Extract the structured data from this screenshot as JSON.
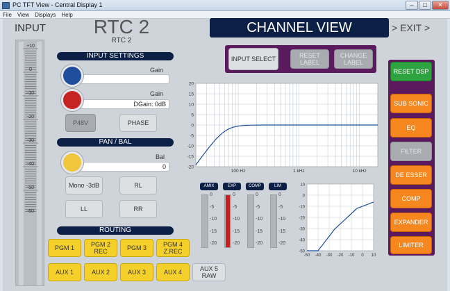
{
  "window": {
    "title": "PC TFT View - Central Display 1",
    "controls": [
      "–",
      "□",
      "✕"
    ]
  },
  "menu": [
    "File",
    "View",
    "Displays",
    "Help"
  ],
  "input_meter": {
    "title": "INPUT",
    "ticks": [
      "+10",
      "0",
      "-10",
      "-20",
      "-30",
      "-40",
      "-50",
      "-60"
    ]
  },
  "channel": {
    "name": "RTC 2",
    "subname": "RTC 2"
  },
  "view_title": "CHANNEL VIEW",
  "exit_label": "> EXIT >",
  "input_settings": {
    "header": "INPUT SETTINGS",
    "gain1_label": "Gain",
    "gain1_value": "",
    "gain2_label": "Gain",
    "gain2_value": "DGain: 0dB",
    "p48v": "P48V",
    "phase": "PHASE",
    "knob1_color": "#1f4e9c",
    "knob2_color": "#c62424"
  },
  "pan": {
    "header": "PAN / BAL",
    "bal_label": "Bal",
    "bal_value": "0",
    "knob_color": "#f0c63a",
    "mono": "Mono -3dB",
    "rl": "RL",
    "ll": "LL",
    "rr": "RR"
  },
  "routing": {
    "header": "ROUTING",
    "row1": [
      "PGM 1",
      "PGM 2 REC",
      "PGM 3",
      "PGM 4 Z.REC"
    ],
    "row2": [
      "AUX 1",
      "AUX 2",
      "AUX 3",
      "AUX 4"
    ],
    "aux5": "AUX 5 RAW"
  },
  "top_buttons": {
    "input_select": "INPUT SELECT",
    "reset_label": "RESET LABEL",
    "change_label": "CHANGE LABEL"
  },
  "dsp_buttons": {
    "reset_dsp": "RESET DSP",
    "items": [
      "SUB SONIC",
      "EQ",
      "FILTER",
      "DE ESSER",
      "COMP",
      "EXPANDER",
      "LIMITER"
    ]
  },
  "eq_graph": {
    "y_ticks": [
      "20",
      "15",
      "10",
      "5",
      "0",
      "-5",
      "-10",
      "-15",
      "-20"
    ],
    "x_labels": [
      "100 Hz",
      "1 kHz",
      "10 kHz"
    ]
  },
  "meters": {
    "labels": [
      "AMIX",
      "EXP",
      "COMP",
      "LIM"
    ],
    "ticks": [
      "0",
      "-5",
      "-10",
      "-15",
      "-20"
    ],
    "red_fill": 1.0
  },
  "comp_graph": {
    "y_ticks": [
      "10",
      "0",
      "-10",
      "-20",
      "-30",
      "-40",
      "-50"
    ],
    "x_ticks": [
      "-50",
      "-40",
      "-30",
      "-20",
      "-10",
      "0",
      "10"
    ]
  }
}
